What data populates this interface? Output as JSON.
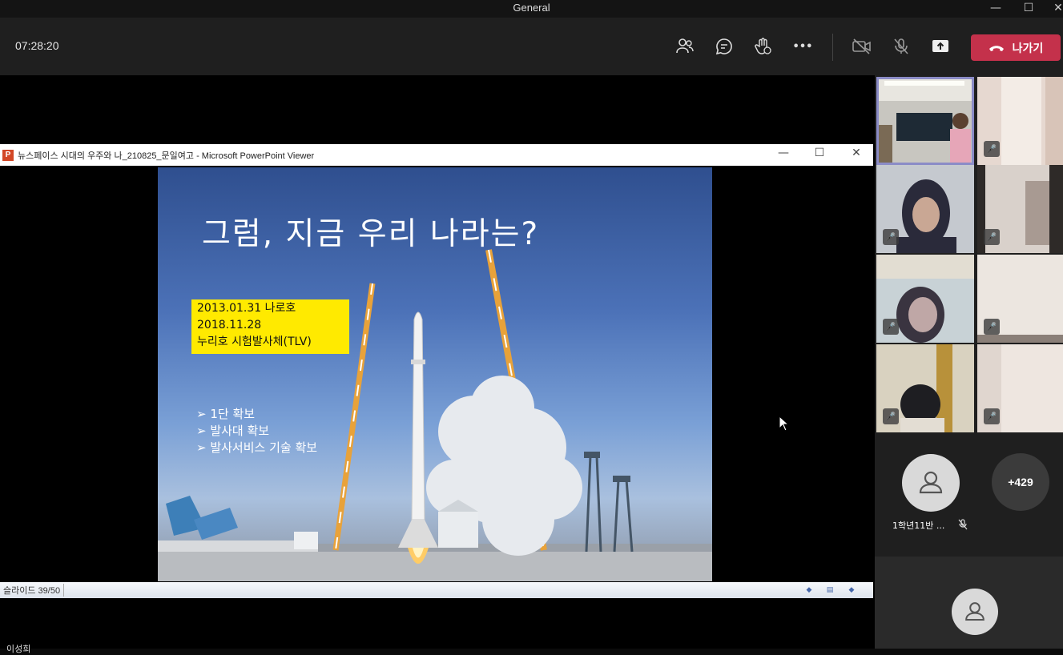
{
  "window": {
    "title": "General",
    "minimize_glyph": "—",
    "maximize_glyph": "☐",
    "close_glyph": "✕"
  },
  "toolbar": {
    "timer": "07:28:20",
    "icons": [
      "participants-icon",
      "chat-icon",
      "raise-hand-icon",
      "more-icon",
      "camera-off-icon",
      "mic-off-icon",
      "share-tray-icon"
    ],
    "more_glyph": "•••",
    "leave_label": "나가기",
    "leave_color": "#c4314b"
  },
  "viewer": {
    "app_icon": "P",
    "title": "뉴스페이스 시대의 우주와 나_210825_문일여고 - Microsoft PowerPoint Viewer",
    "minimize_glyph": "—",
    "maximize_glyph": "☐",
    "close_glyph": "✕",
    "status_slide": "슬라이드 39/50"
  },
  "slide": {
    "heading": "그럼, 지금 우리 나라는?",
    "dates": [
      "2013.01.31 나로호",
      "2018.11.28",
      "누리호 시험발사체(TLV)"
    ],
    "bullets": [
      "➢ 1단 확보",
      "➢ 발사대 확보",
      "➢ 발사서비스 기술 확보"
    ],
    "highlight_color": "#ffea00"
  },
  "presenter_name": "이성희",
  "roster": {
    "selected_border_color": "#8b8cc7",
    "attendee_name": "1학년11반 ...",
    "overflow_count": "+429"
  }
}
